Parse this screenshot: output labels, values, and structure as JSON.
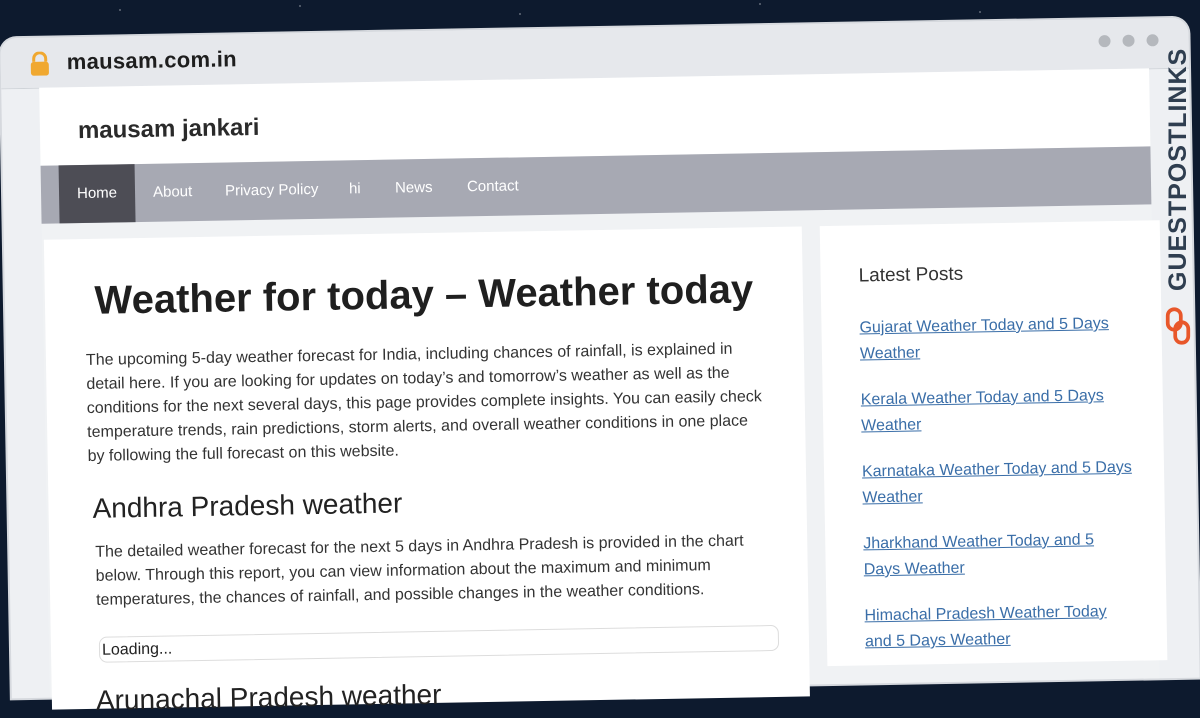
{
  "browser": {
    "url": "mausam.com.in"
  },
  "site": {
    "title": "mausam jankari",
    "nav": [
      "Home",
      "About",
      "Privacy Policy",
      "hi",
      "News",
      "Contact"
    ]
  },
  "main": {
    "title": "Weather for today – Weather today",
    "intro": "The upcoming 5-day weather forecast for India, including chances of rainfall, is explained in detail here. If you are looking for updates on today’s and tomorrow’s weather as well as the conditions for the next several days, this page provides complete insights. You can easily check temperature trends, rain predictions, storm alerts, and overall weather conditions in one place by following the full forecast on this website.",
    "section1_heading": "Andhra Pradesh weather",
    "section1_text": "The detailed weather forecast for the next 5 days in Andhra Pradesh is provided in the chart below. Through this report, you can view information about the maximum and minimum temperatures, the chances of rainfall, and possible changes in the weather conditions.",
    "loading": "Loading...",
    "section2_heading": "Arunachal Pradesh weather"
  },
  "sidebar": {
    "heading": "Latest Posts",
    "links": [
      "Gujarat Weather Today and 5 Days Weather",
      "Kerala Weather Today and 5 Days Weather",
      "Karnataka Weather Today and 5 Days Weather",
      "Jharkhand Weather Today and 5 Days Weather",
      "Himachal Pradesh Weather Today and 5 Days Weather"
    ]
  },
  "watermark": "GUESTPOSTLINKS",
  "colors": {
    "nav_bg": "#a7a9b3",
    "nav_active": "#4d4d55",
    "link": "#3a6ea8",
    "lock": "#f0a830",
    "watermark_accent": "#e8572a"
  }
}
